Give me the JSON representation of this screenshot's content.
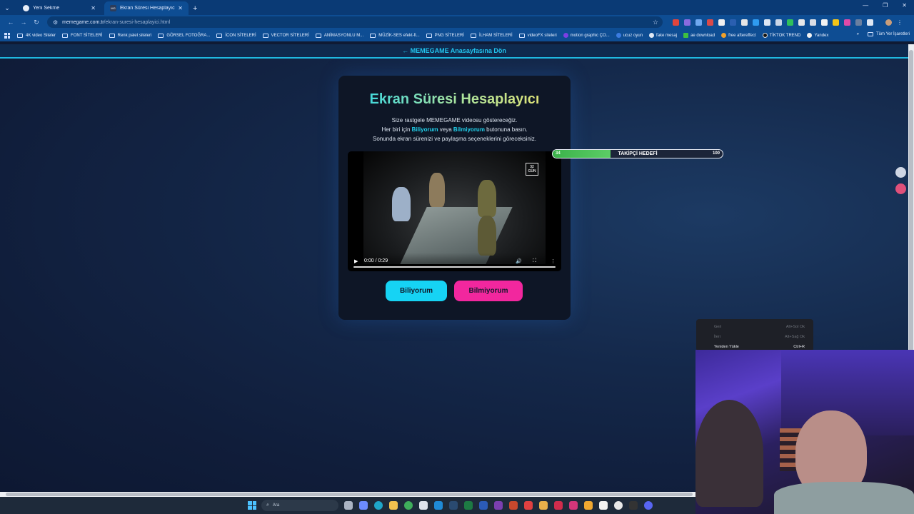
{
  "browser": {
    "tabs": [
      {
        "title": "Yeni Sekme",
        "active": false
      },
      {
        "title": "Ekran Süresi Hesaplayıcı | MEM",
        "active": true
      }
    ],
    "url_host": "memegame.com.tr",
    "url_path": "/ekran-suresi-hesaplayici.html",
    "bookmarks": [
      "4K video Siteler",
      "FONT SİTELERİ",
      "Renk palet siteleri",
      "GÖRSEL FOTOĞRA...",
      "İCON SİTELERİ",
      "VECTOR SİTELERİ",
      "ANİMASYONLU M...",
      "MÜZİK-SES efekt-fi...",
      "PNG SİTELERİ",
      "İLHAM SİTELERİ",
      "videoFX siteleri",
      "motion graphic ÇO...",
      "ucuz oyun",
      "fake mesaj",
      "ae download",
      "free aftereffect",
      "TİKTOK TREND",
      "Yandex"
    ],
    "bookmarks_all": "Tüm Yer İşaretleri"
  },
  "page": {
    "home_link": "← MEMEGAME Anasayfasına Dön",
    "title": "Ekran Süresi Hesaplayıcı",
    "desc_line1": "Size rastgele MEMEGAME videosu göstereceğiz.",
    "desc_line2_pre": "Her biri için ",
    "desc_know": "Biliyorum",
    "desc_mid": " veya ",
    "desc_dont": "Bilmiyorum",
    "desc_line2_post": " butonuna basın.",
    "desc_line3": "Sonunda ekran sürenizi ve paylaşma seçeneklerini göreceksiniz.",
    "video_time": "0:00 / 0:29",
    "video_logo": "32 GÜN",
    "video_progress": 0,
    "btn_know": "Biliyorum",
    "btn_dont": "Bilmiyorum"
  },
  "follower_goal": {
    "current": "34",
    "label": "TAKİPÇİ HEDEFİ",
    "goal": "100",
    "fraction": 0.34
  },
  "context_menu": {
    "items": [
      {
        "label": "Geri",
        "shortcut": "Alt+Sol Ok",
        "enabled": false
      },
      {
        "label": "İleri",
        "shortcut": "Alt+Sağ Ok",
        "enabled": false
      },
      {
        "label": "Yeniden Yükle",
        "shortcut": "Ctrl+R",
        "enabled": true
      }
    ]
  },
  "taskbar": {
    "search_placeholder": "Ara"
  }
}
